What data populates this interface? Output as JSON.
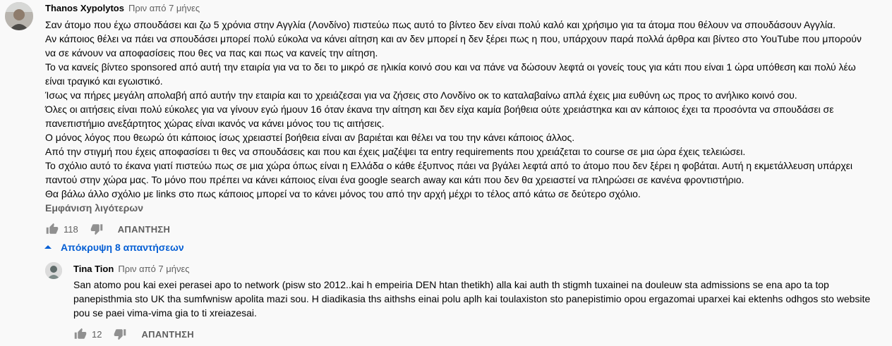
{
  "comment": {
    "author": "Thanos Xypolytos",
    "time": "Πριν από 7 μήνες",
    "paragraphs": [
      "Σαν άτομο που έχω σπουδάσει και ζω 5 χρόνια στην Αγγλία (Λονδίνο) πιστεύω πως αυτό το βίντεο δεν είναι πολύ καλό και χρήσιμο για τα άτομα που θέλουν να σπουδάσουν Αγγλία.",
      "Αν κάποιος θέλει να πάει να σπουδάσει μπορεί πολύ εύκολα να κάνει αίτηση και αν δεν μπορεί η δεν ξέρει πως η που, υπάρχουν παρά πολλά άρθρα και βίντεο στο YouTube που μπορούν να σε κάνουν να αποφασίσεις που θες να πας και πως να κανείς την αίτηση.",
      "Το να κανείς βίντεο sponsored από αυτή την εταιρία για να το δει το μικρό σε ηλικία κοινό σου και να πάνε να δώσουν λεφτά οι γονείς τους για κάτι που είναι 1 ώρα υπόθεση και πολύ λέω είναι τραγικό και εγωιστικό.",
      "Ίσως να πήρες μεγάλη απολαβή από αυτήν την εταιρία και το χρειάζεσαι για να ζήσεις στο Λονδίνο οκ το καταλαβαίνω απλά έχεις μια ευθύνη ως προς το ανήλικο κοινό σου.",
      "Όλες οι αιτήσεις είναι πολύ εύκολες για να γίνουν εγώ ήμουν 16 όταν έκανα την αίτηση και δεν είχα καμία βοήθεια ούτε χρειάστηκα και αν κάποιος έχει τα προσόντα να σπουδάσει σε πανεπιστήμιο ανεξάρτητος χώρας είναι ικανός να κάνει μόνος του τις αιτήσεις.",
      "Ο μόνος λόγος που θεωρώ ότι κάποιος ίσως χρειαστεί βοήθεια είναι αν βαριέται και θέλει να του την κάνει κάποιος άλλος.",
      "Από την στιγμή που έχεις αποφασίσει τι θες να σπουδάσεις και που και έχεις μαζέψει τα entry requirements που χρειάζεται το course σε μια ώρα έχεις τελειώσει.",
      "Το σχόλιο αυτό το έκανα γιατί πιστεύω πως σε μια χώρα όπως είναι η Ελλάδα ο κάθε έξυπνος πάει να βγάλει λεφτά από το άτομο που δεν ξέρει η φοβάται. Αυτή η εκμετάλλευση υπάρχει παντού στην χώρα μας. Το μόνο που πρέπει να κάνει κάποιος είναι ένα google search away και κάτι που δεν θα χρειαστεί να πληρώσει σε κανένα φροντιστήριο.",
      "Θα βάλω άλλο σχόλιο με links στο πως κάποιος μπορεί να το κάνει μόνος του από την αρχή μέχρι το τέλος από κάτω σε δεύτερο σχόλιο."
    ],
    "show_less": "Εμφάνιση λιγότερων",
    "likes": "118",
    "reply_label": "ΑΠΑΝΤΗΣΗ"
  },
  "replies_toggle": {
    "label": "Απόκρυψη 8 απαντήσεων"
  },
  "reply": {
    "author": "Tina Tion",
    "time": "Πριν από 7 μήνες",
    "paragraphs": [
      "San atomo pou kai exei perasei apo to network (pisw sto 2012..kai h empeiria DEN htan thetikh) alla kai auth th stigmh tuxainei na douleuw sta admissions se ena apo ta top panepisthmia sto UK tha sumfwnisw apolita mazi sou. H diadikasia ths aithshs einai polu aplh kai toulaxiston sto panepistimio opou ergazomai uparxei kai ektenhs odhgos sto website pou se paei vima-vima gia to ti xreiazesai."
    ],
    "likes": "12",
    "reply_label": "ΑΠΑΝΤΗΣΗ"
  },
  "colors": {
    "link": "#065fd4",
    "secondary": "#606060",
    "background": "#f9f9f9"
  },
  "icons": [
    "avatar",
    "thumb-up-icon",
    "thumb-down-icon",
    "chevron-up-icon"
  ]
}
